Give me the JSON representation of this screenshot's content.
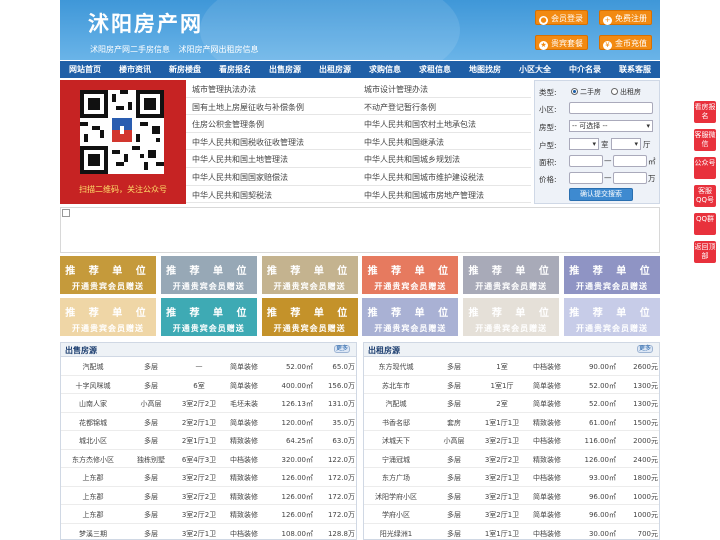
{
  "header": {
    "logo": "沭阳房产网",
    "subtitle": "沭阳房产网二手房信息 沭阳房产网出租房信息",
    "buttons": [
      {
        "label": "会员登录",
        "icon": "user-icon"
      },
      {
        "label": "免费注册",
        "icon": "register-icon"
      },
      {
        "label": "贵宾套餐",
        "icon": "vip-icon"
      },
      {
        "label": "金币充值",
        "icon": "coin-icon"
      }
    ]
  },
  "nav": [
    "网站首页",
    "楼市资讯",
    "新房楼盘",
    "看房报名",
    "出售房源",
    "出租房源",
    "求购信息",
    "求租信息",
    "地图找房",
    "小区大全",
    "中介名录",
    "联系客服"
  ],
  "qr": {
    "caption": "扫描二维码，关注公众号"
  },
  "links": [
    [
      "城市管理执法办法",
      "城市设计管理办法"
    ],
    [
      "国有土地上房屋征收与补偿条例",
      "不动产登记暂行条例"
    ],
    [
      "住房公积金管理条例",
      "中华人民共和国农村土地承包法"
    ],
    [
      "中华人民共和国税收征收管理法",
      "中华人民共和国继承法"
    ],
    [
      "中华人民共和国土地管理法",
      "中华人民共和国城乡规划法"
    ],
    [
      "中华人民共和国国家赔偿法",
      "中华人民共和国城市维护建设税法"
    ],
    [
      "中华人民共和国契税法",
      "中华人民共和国城市房地产管理法"
    ]
  ],
  "search": {
    "type_label": "类型:",
    "opt1": "二手房",
    "opt2": "出租房",
    "community_label": "小区:",
    "house_label": "房型:",
    "house_value": "-- 可选择 --",
    "layout_label": "户型:",
    "room_unit": "室",
    "hall_unit": "厅",
    "area_label": "面积:",
    "area_unit": "㎡",
    "price_label": "价格:",
    "price_unit": "万",
    "dash": "—",
    "submit": "确认提交搜索"
  },
  "tiles": {
    "title": "推 荐 单 位",
    "sub": "开通贵宾会员赠送",
    "colors": [
      "#c59a3b",
      "#97a8b6",
      "#c4b38f",
      "#e67a5f",
      "#a8aab8",
      "#8f94c4",
      "#efd6a6",
      "#3eaab4",
      "#c4922a",
      "#a9b1d4",
      "#e5e0d8",
      "#c7cce8"
    ]
  },
  "sale": {
    "title": "出售房源",
    "more": "更多",
    "rows": [
      [
        "汽配城",
        "多层",
        "—",
        "简单装修",
        "52.00㎡",
        "65.0万"
      ],
      [
        "十字风咪城",
        "多层",
        "6室",
        "简单装修",
        "400.00㎡",
        "156.0万"
      ],
      [
        "山南人家",
        "小高层",
        "3室2厅2卫",
        "毛坯未装",
        "126.13㎡",
        "131.0万"
      ],
      [
        "花都锦城",
        "多层",
        "2室2厅1卫",
        "简单装修",
        "120.00㎡",
        "35.0万"
      ],
      [
        "城北小区",
        "多层",
        "2室1厅1卫",
        "精致装修",
        "64.25㎡",
        "63.0万"
      ],
      [
        "东方杰修小区",
        "独栋别墅",
        "6室4厅3卫",
        "中档装修",
        "320.00㎡",
        "122.0万"
      ],
      [
        "上东郡",
        "多层",
        "3室2厅2卫",
        "精致装修",
        "126.00㎡",
        "172.0万"
      ],
      [
        "上东郡",
        "多层",
        "3室2厅2卫",
        "精致装修",
        "126.00㎡",
        "172.0万"
      ],
      [
        "上东郡",
        "多层",
        "3室2厅2卫",
        "精致装修",
        "126.00㎡",
        "172.0万"
      ],
      [
        "梦溪三期",
        "多层",
        "3室2厅1卫",
        "中档装修",
        "108.00㎡",
        "128.8万"
      ]
    ]
  },
  "rent": {
    "title": "出租房源",
    "more": "更多",
    "rows": [
      [
        "东方现代城",
        "多层",
        "1室",
        "中档装修",
        "90.00㎡",
        "2600元"
      ],
      [
        "苏北车市",
        "多层",
        "1室1厅",
        "简单装修",
        "52.00㎡",
        "1300元"
      ],
      [
        "汽配城",
        "多层",
        "2室",
        "简单装修",
        "52.00㎡",
        "1300元"
      ],
      [
        "书香名邸",
        "套房",
        "1室1厅1卫",
        "精致装修",
        "61.00㎡",
        "1500元"
      ],
      [
        "沭城天下",
        "小高层",
        "3室2厅1卫",
        "中档装修",
        "116.00㎡",
        "2000元"
      ],
      [
        "宁涌冠城",
        "多层",
        "3室2厅2卫",
        "精致装修",
        "126.00㎡",
        "2400元"
      ],
      [
        "东方广场",
        "多层",
        "3室2厅1卫",
        "中档装修",
        "93.00㎡",
        "1800元"
      ],
      [
        "沭阳学府小区",
        "多层",
        "3室2厅1卫",
        "简单装修",
        "96.00㎡",
        "1000元"
      ],
      [
        "学府小区",
        "多层",
        "3室2厅1卫",
        "简单装修",
        "96.00㎡",
        "1000元"
      ],
      [
        "阳光绿洲1",
        "多层",
        "1室1厅1卫",
        "中档装修",
        "30.00㎡",
        "700元"
      ]
    ]
  },
  "side": [
    "看房报名",
    "客服微信",
    "公众号",
    "客服QQ号",
    "QQ群",
    "返回顶部"
  ]
}
